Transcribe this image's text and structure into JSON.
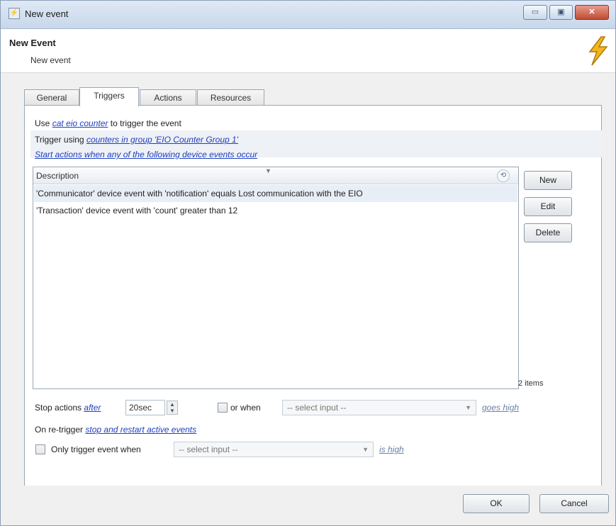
{
  "window": {
    "title": "New event",
    "icon": "event-window-icon"
  },
  "window_controls": {
    "minimize": "▭",
    "maximize": "▣",
    "close": "✕"
  },
  "header": {
    "title": "New Event",
    "subtitle": "New event",
    "icon": "lightning-bolt-icon",
    "accent_color": "#f2b51e"
  },
  "tabs": [
    {
      "label": "General",
      "active": false
    },
    {
      "label": "Triggers",
      "active": true
    },
    {
      "label": "Actions",
      "active": false
    },
    {
      "label": "Resources",
      "active": false
    }
  ],
  "triggers": {
    "use_prefix": "Use",
    "use_link": "cat eio counter",
    "use_suffix": "to trigger the event",
    "trigger_prefix": "Trigger using",
    "trigger_link": "counters in group 'EIO Counter Group 1'",
    "start_link": "Start actions when any of the following device events occur",
    "list": {
      "column_header": "Description",
      "sort_glyph": "▼",
      "rows": [
        "'Communicator' device event with 'notification' equals Lost communication with the EIO",
        "'Transaction' device event with 'count' greater than 12"
      ],
      "count_label": "2 items"
    },
    "buttons": {
      "new": "New",
      "edit": "Edit",
      "delete": "Delete"
    },
    "stop": {
      "label": "Stop actions",
      "link": "after",
      "value": "20sec",
      "or_when": "or when",
      "select_placeholder": "-- select input --",
      "state_link": "goes high"
    },
    "retrigger": {
      "label": "On re-trigger",
      "link": "stop and restart active events"
    },
    "only_trigger": {
      "label": "Only trigger event when",
      "select_placeholder": "-- select input --",
      "state_link": "is high"
    }
  },
  "footer": {
    "ok": "OK",
    "cancel": "Cancel"
  },
  "colors": {
    "link": "#1f3fbf",
    "selected_row": "#e8eef6",
    "title_gradient_top": "#dfe9f5"
  }
}
